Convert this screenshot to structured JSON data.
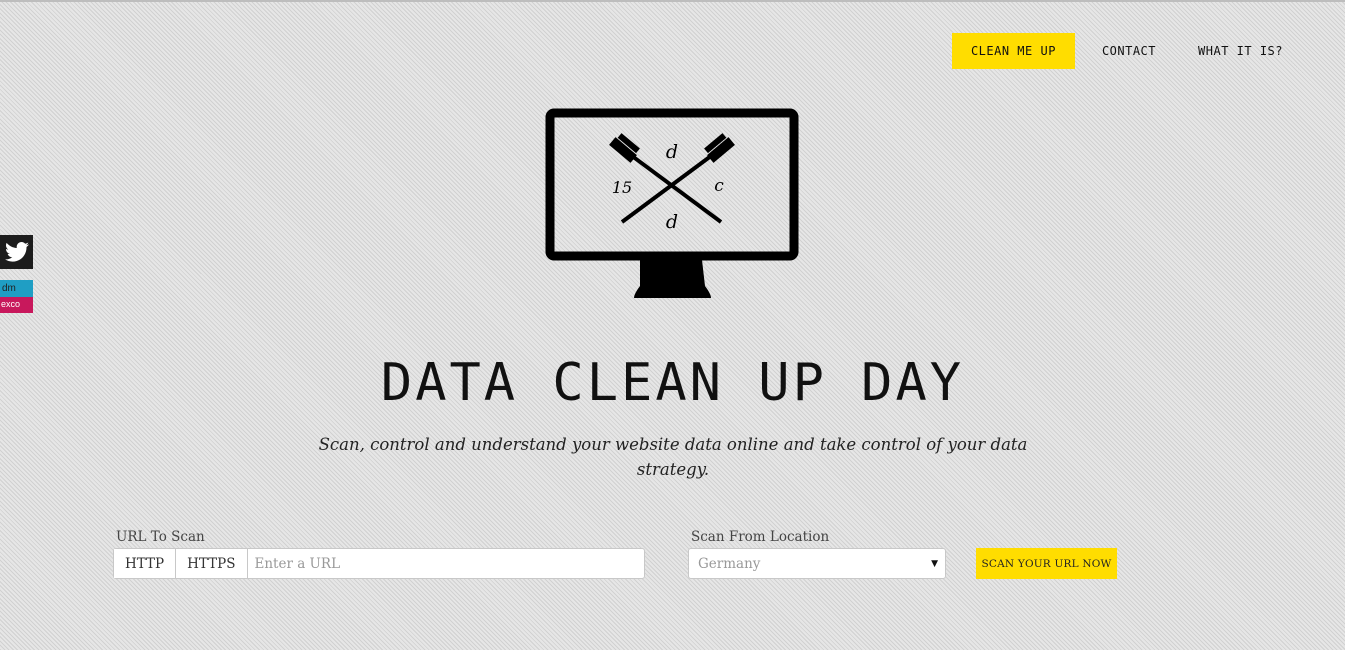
{
  "nav": {
    "items": [
      {
        "label": "CLEAN ME UP"
      },
      {
        "label": "CONTACT"
      },
      {
        "label": "WHAT IT IS?"
      }
    ]
  },
  "social": {
    "dmexco_top": "dm",
    "dmexco_bottom": "exco"
  },
  "logo": {
    "letters": [
      "d",
      "15",
      "c",
      "d"
    ]
  },
  "hero": {
    "title": "DATA CLEAN UP DAY",
    "subtitle": "Scan, control and understand your website data online and take control of your data strategy."
  },
  "form": {
    "url_label": "URL To Scan",
    "http_label": "HTTP",
    "https_label": "HTTPS",
    "url_placeholder": "Enter a URL",
    "location_label": "Scan From Location",
    "location_value": "Germany",
    "submit_label": "SCAN YOUR URL NOW"
  },
  "colors": {
    "accent": "#ffdd00",
    "twitter_bg": "#1d1d1d",
    "dmexco_blue": "#1f9ec4",
    "dmexco_pink": "#c8185c"
  }
}
